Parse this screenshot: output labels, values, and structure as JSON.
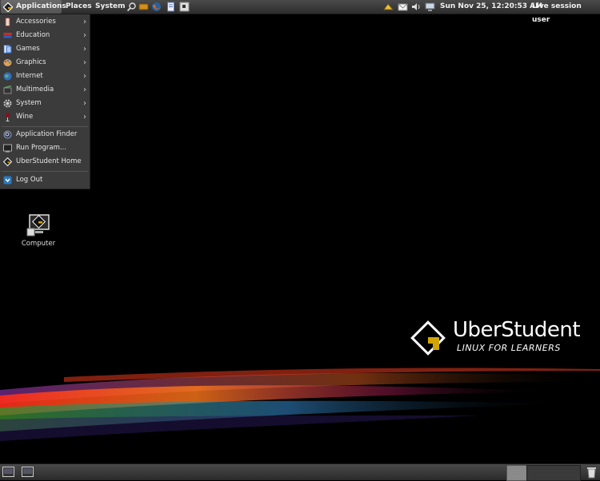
{
  "top_panel": {
    "applications": "Applications",
    "places": "Places",
    "system": "System",
    "clock": "Sun Nov 25, 12:20:53 AM",
    "user": "Live session user"
  },
  "app_menu": {
    "items": [
      {
        "label": "Accessories",
        "icon": "accessories-icon"
      },
      {
        "label": "Education",
        "icon": "education-icon"
      },
      {
        "label": "Games",
        "icon": "games-icon"
      },
      {
        "label": "Graphics",
        "icon": "graphics-icon"
      },
      {
        "label": "Internet",
        "icon": "internet-icon"
      },
      {
        "label": "Multimedia",
        "icon": "multimedia-icon"
      },
      {
        "label": "System",
        "icon": "system-icon"
      },
      {
        "label": "Wine",
        "icon": "wine-icon"
      }
    ],
    "actions": [
      {
        "label": "Application Finder",
        "icon": "magnifier-icon"
      },
      {
        "label": "Run Program...",
        "icon": "run-icon"
      },
      {
        "label": "UberStudent Home",
        "icon": "uberstudent-icon"
      }
    ],
    "logout": "Log Out"
  },
  "desktop": {
    "computer_label": "Computer"
  },
  "brand": {
    "name": "UberStudent",
    "tagline": "LINUX FOR LEARNERS"
  },
  "colors": {
    "accent": "#d4a500",
    "panel": "#3b3b3b"
  }
}
